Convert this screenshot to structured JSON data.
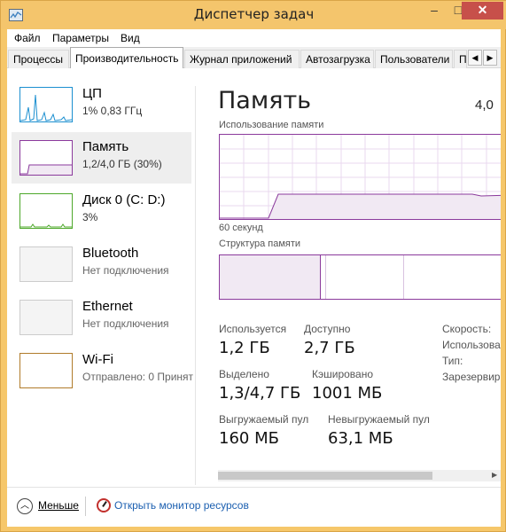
{
  "window": {
    "title": "Диспетчер задач",
    "minimize": "–",
    "maximize": "□",
    "close": "✕"
  },
  "menu": [
    "Файл",
    "Параметры",
    "Вид"
  ],
  "tabs": [
    {
      "label": "Процессы",
      "active": false
    },
    {
      "label": "Производительность",
      "active": true
    },
    {
      "label": "Журнал приложений",
      "active": false
    },
    {
      "label": "Автозагрузка",
      "active": false
    },
    {
      "label": "Пользователи",
      "active": false
    },
    {
      "label": "П",
      "active": false
    }
  ],
  "tab_scroll": {
    "left": "◀",
    "right": "▶"
  },
  "sidebar": {
    "items": [
      {
        "name": "ЦП",
        "sub": "1% 0,83 ГГц",
        "color": "#1b8fd0"
      },
      {
        "name": "Память",
        "sub": "1,2/4,0 ГБ (30%)",
        "color": "#8b3a9c",
        "selected": true
      },
      {
        "name": "Диск 0 (C: D:)",
        "sub": "3%",
        "color": "#4da82a"
      },
      {
        "name": "Bluetooth",
        "sub": "Нет подключения",
        "color": "#c8c8c8"
      },
      {
        "name": "Ethernet",
        "sub": "Нет подключения",
        "color": "#c8c8c8"
      },
      {
        "name": "Wi-Fi",
        "sub": "Отправлено: 0 Принят",
        "color": "#b07b2a"
      }
    ]
  },
  "main": {
    "title": "Память",
    "total": "4,0 ",
    "usage_label": "Использование памяти",
    "time_label": "60 секунд",
    "composition_label": "Структура памяти",
    "usage_percent": 30,
    "stats": {
      "in_use_label": "Используется",
      "in_use_value": "1,2 ГБ",
      "available_label": "Доступно",
      "available_value": "2,7 ГБ",
      "committed_label": "Выделено",
      "committed_value": "1,3/4,7 ГБ",
      "cached_label": "Кэшировано",
      "cached_value": "1001 МБ",
      "paged_label": "Выгружаемый пул",
      "paged_value": "160 МБ",
      "nonpaged_label": "Невыгружаемый пул",
      "nonpaged_value": "63,1 МБ"
    },
    "right_labels": [
      "Скорость:",
      "Использова",
      "Тип:",
      "Зарезервир"
    ]
  },
  "footer": {
    "fewer_label": "Меньше",
    "fewer_icon": "chevron-up-icon",
    "resmon_label": "Открыть монитор ресурсов",
    "resmon_icon": "resource-monitor-icon"
  },
  "colors": {
    "accent_memory": "#8b3a9c",
    "title_bar": "#f4c56c",
    "close": "#c7504a",
    "link": "#1b5fb0"
  }
}
